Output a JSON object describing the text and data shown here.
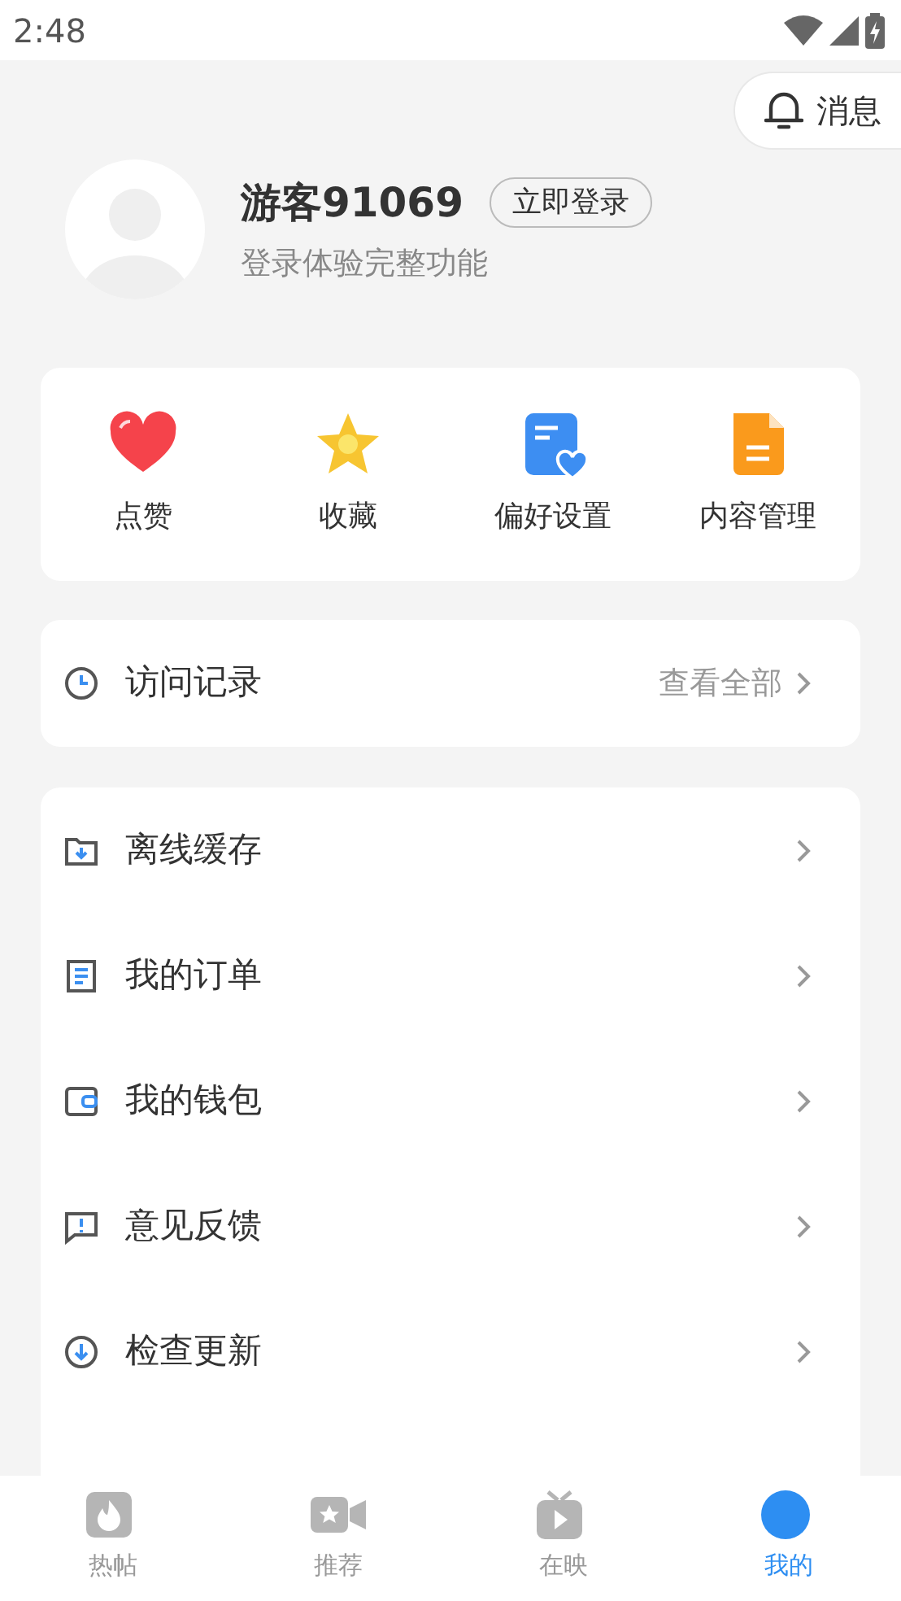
{
  "status_bar": {
    "time": "2:48"
  },
  "messages_button": {
    "label": "消息"
  },
  "profile": {
    "name": "游客91069",
    "login_button": "立即登录",
    "subtitle": "登录体验完整功能"
  },
  "shortcuts": [
    {
      "label": "点赞",
      "kind": "heart"
    },
    {
      "label": "收藏",
      "kind": "star"
    },
    {
      "label": "偏好设置",
      "kind": "preference"
    },
    {
      "label": "内容管理",
      "kind": "document"
    }
  ],
  "history": {
    "label": "访问记录",
    "action": "查看全部"
  },
  "menu": [
    {
      "label": "离线缓存",
      "kind": "download-folder"
    },
    {
      "label": "我的订单",
      "kind": "order"
    },
    {
      "label": "我的钱包",
      "kind": "wallet"
    },
    {
      "label": "意见反馈",
      "kind": "feedback"
    },
    {
      "label": "检查更新",
      "kind": "update"
    }
  ],
  "tabs": [
    {
      "label": "热帖",
      "kind": "fire",
      "selected": false
    },
    {
      "label": "推荐",
      "kind": "video",
      "selected": false
    },
    {
      "label": "在映",
      "kind": "tv",
      "selected": false
    },
    {
      "label": "我的",
      "kind": "me",
      "selected": true
    }
  ]
}
